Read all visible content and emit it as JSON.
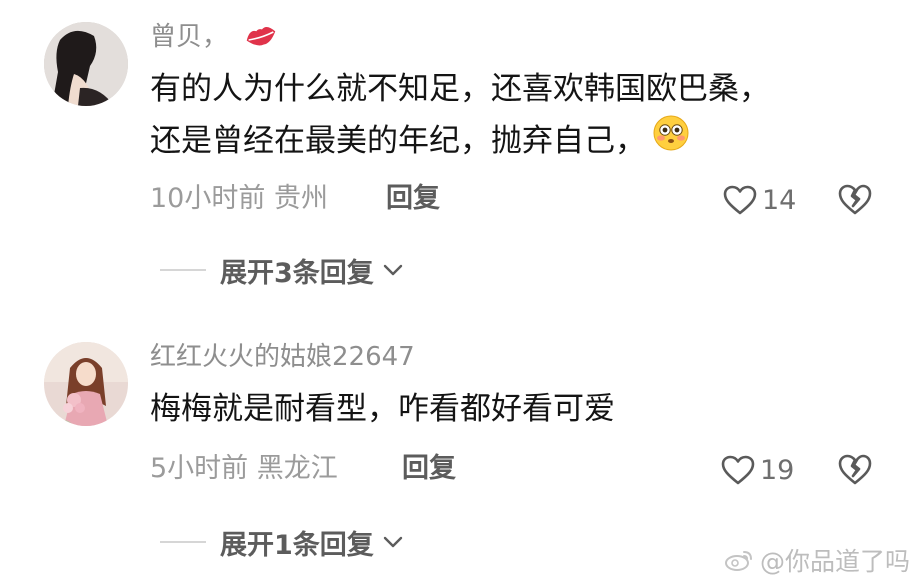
{
  "comments": [
    {
      "username": "曾贝，",
      "lines": [
        "有的人为什么就不知足，还喜欢韩国欧巴桑，",
        "还是曾经在最美的年纪，抛弃自己，"
      ],
      "emoji_icon": "flushed-face-icon",
      "time_location": "10小时前 贵州",
      "reply_label": "回复",
      "likes": "14",
      "expand_label": "展开3条回复"
    },
    {
      "username": "红红火火的姑娘22647",
      "lines": [
        "梅梅就是耐看型，咋看都好看可爱"
      ],
      "time_location": "5小时前 黑龙江",
      "reply_label": "回复",
      "likes": "19",
      "expand_label": "展开1条回复"
    }
  ],
  "watermark": "@你品道了吗",
  "colors": {
    "username": "#8e8e8e",
    "text": "#141414",
    "meta": "#9b9b9b",
    "lips": "#e0334a"
  }
}
